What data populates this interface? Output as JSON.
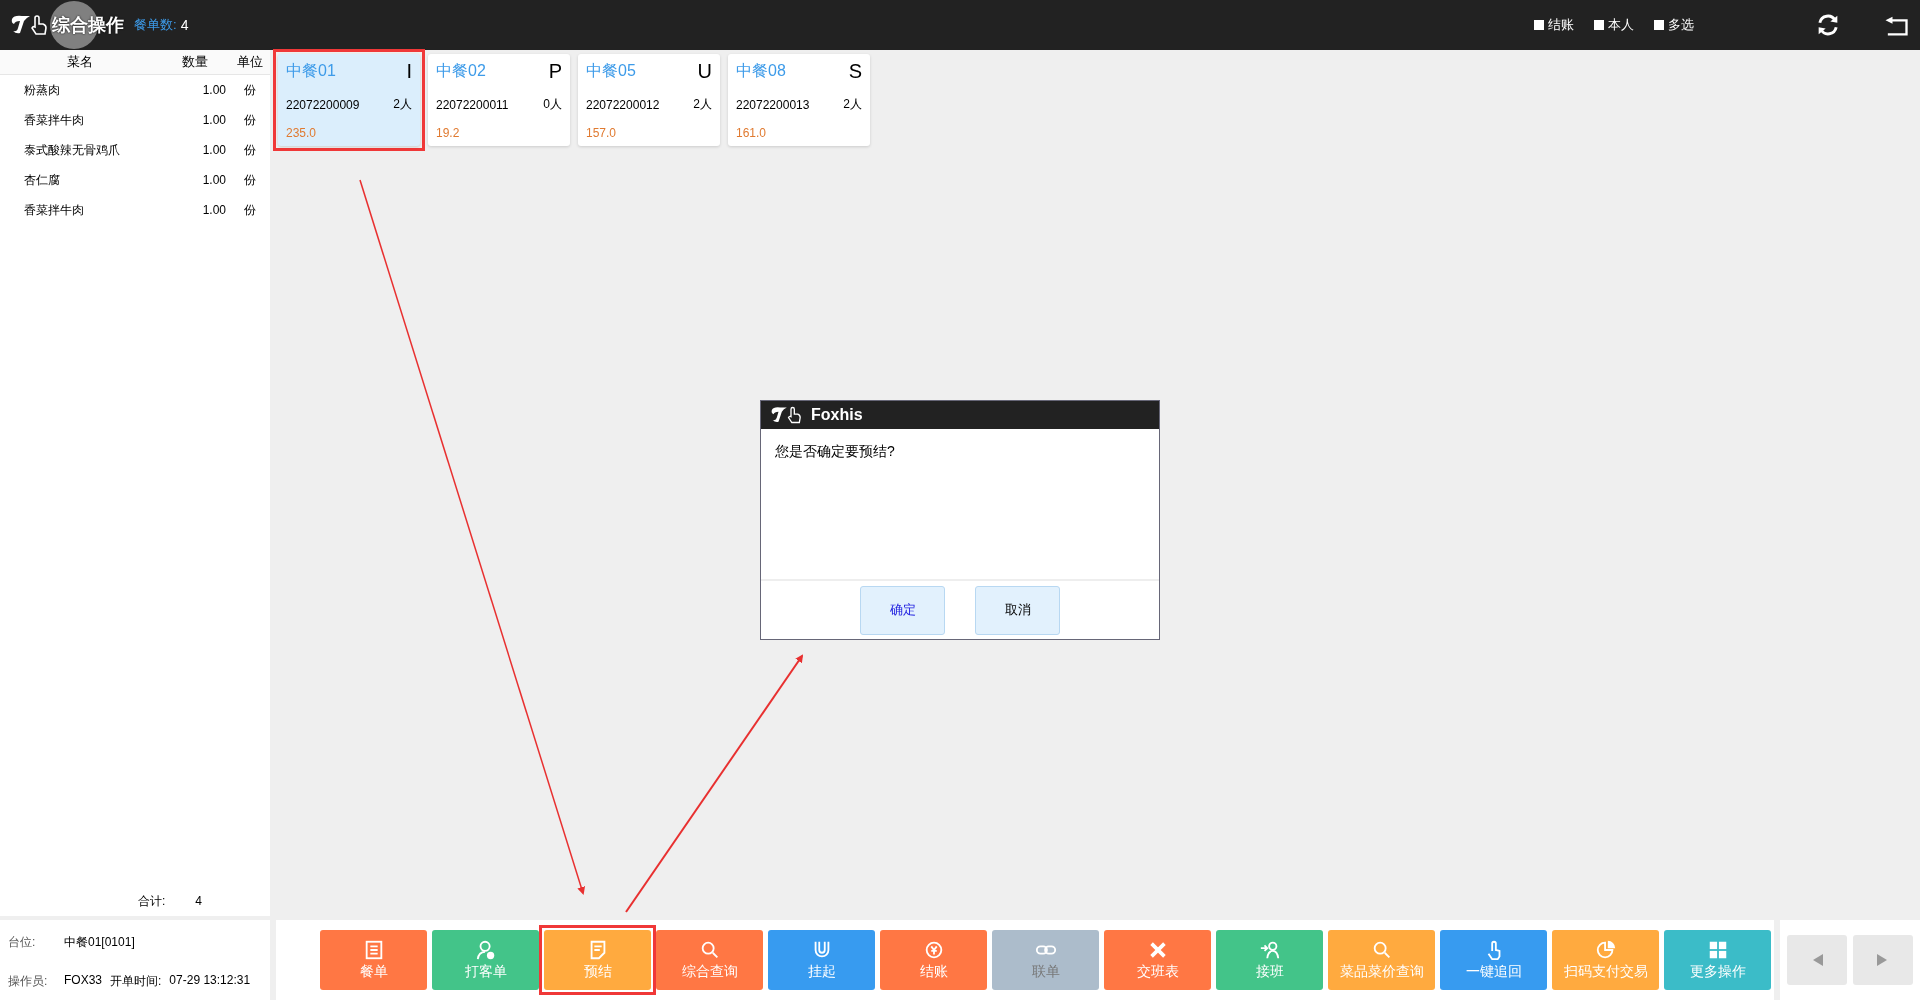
{
  "header": {
    "title": "综合操作",
    "order_count_label": "餐单数:",
    "order_count": "4",
    "filters": [
      {
        "label": "结账",
        "checked": false
      },
      {
        "label": "本人",
        "checked": false
      },
      {
        "label": "多选",
        "checked": false
      }
    ]
  },
  "dish_list": {
    "columns": [
      "菜名",
      "数量",
      "单位"
    ],
    "rows": [
      [
        "粉蒸肉",
        "1.00",
        "份"
      ],
      [
        "香菜拌牛肉",
        "1.00",
        "份"
      ],
      [
        "泰式酸辣无骨鸡爪",
        "1.00",
        "份"
      ],
      [
        "杏仁腐",
        "1.00",
        "份"
      ],
      [
        "香菜拌牛肉",
        "1.00",
        "份"
      ]
    ],
    "total_label": "合计:",
    "total": "4"
  },
  "order_info": {
    "table_label": "台位:",
    "table": "中餐01[0101]",
    "operator_label": "操作员:",
    "operator": "FOX33",
    "open_time_label": "开单时间:",
    "open_time": "07-29 13:12:31"
  },
  "orders": [
    {
      "table": "中餐01",
      "status": "I",
      "order_no": "22072200009",
      "guests": "2人",
      "amount": "235.0",
      "selected": true,
      "highlighted": true
    },
    {
      "table": "中餐02",
      "status": "P",
      "order_no": "22072200011",
      "guests": "0人",
      "amount": "19.2",
      "selected": false,
      "highlighted": false
    },
    {
      "table": "中餐05",
      "status": "U",
      "order_no": "22072200012",
      "guests": "2人",
      "amount": "157.0",
      "selected": false,
      "highlighted": false
    },
    {
      "table": "中餐08",
      "status": "S",
      "order_no": "22072200013",
      "guests": "2人",
      "amount": "161.0",
      "selected": false,
      "highlighted": false
    }
  ],
  "actions": [
    {
      "label": "餐单",
      "color": "#ff7744",
      "disabled": false,
      "highlighted": false
    },
    {
      "label": "打客单",
      "color": "#43c489",
      "disabled": false,
      "highlighted": false
    },
    {
      "label": "预结",
      "color": "#ffaa3f",
      "disabled": false,
      "highlighted": true
    },
    {
      "label": "综合查询",
      "color": "#ff7744",
      "disabled": false,
      "highlighted": false
    },
    {
      "label": "挂起",
      "color": "#379bf0",
      "disabled": false,
      "highlighted": false
    },
    {
      "label": "结账",
      "color": "#ff7744",
      "disabled": false,
      "highlighted": false
    },
    {
      "label": "联单",
      "color": "#acbccb",
      "disabled": true,
      "highlighted": false
    },
    {
      "label": "交班表",
      "color": "#ff7744",
      "disabled": false,
      "highlighted": false
    },
    {
      "label": "接班",
      "color": "#43c489",
      "disabled": false,
      "highlighted": false
    },
    {
      "label": "菜品菜价查询",
      "color": "#ffaa3f",
      "disabled": false,
      "highlighted": false
    },
    {
      "label": "一键追回",
      "color": "#379bf0",
      "disabled": false,
      "highlighted": false
    },
    {
      "label": "扫码支付交易",
      "color": "#ffaa3f",
      "disabled": false,
      "highlighted": false
    },
    {
      "label": "更多操作",
      "color": "#3bbcc8",
      "disabled": false,
      "highlighted": false
    }
  ],
  "dialog": {
    "title": "Foxhis",
    "message": "您是否确定要预结?",
    "buttons": [
      {
        "label": "确定",
        "primary": true
      },
      {
        "label": "取消",
        "primary": false
      }
    ]
  }
}
